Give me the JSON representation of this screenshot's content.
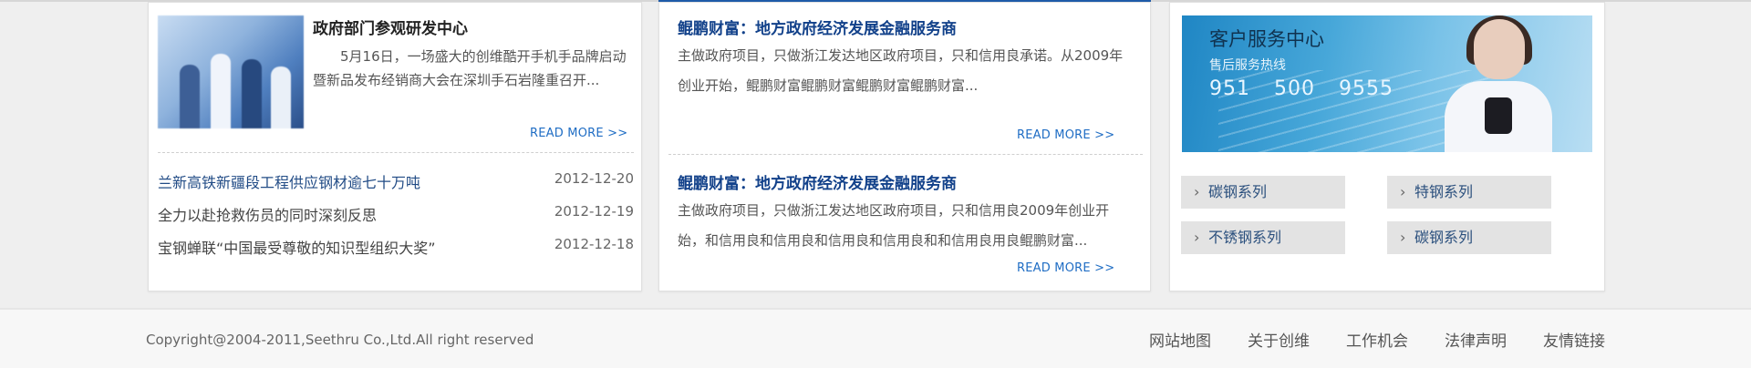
{
  "featured": {
    "title": "政府部门参观研发中心",
    "description": "5月16日，一场盛大的创维酷开手机手品牌启动暨新品发布经销商大会在深圳手石岩隆重召开...",
    "read_more": "READ MORE >>"
  },
  "news": [
    {
      "title": "兰新高铁新疆段工程供应钢材逾七十万吨",
      "date": "2012-12-20"
    },
    {
      "title": "全力以赴抢救伤员的同时深刻反思",
      "date": "2012-12-19"
    },
    {
      "title": "宝钢蝉联“中国最受尊敬的知识型组织大奖”",
      "date": "2012-12-18"
    }
  ],
  "articles": [
    {
      "title": "鲲鹏财富：地方政府经济发展金融服务商",
      "text": "主做政府项目，只做浙江发达地区政府项目，只和信用良承诺。从2009年创业开始，鲲鹏财富鲲鹏财富鲲鹏财富鲲鹏财富...",
      "read_more": "READ MORE >>"
    },
    {
      "title": "鲲鹏财富：地方政府经济发展金融服务商",
      "text": "主做政府项目，只做浙江发达地区政府项目，只和信用良2009年创业开始，和信用良和信用良和信用良和信用良和和信用良用良鲲鹏财富...",
      "read_more": "READ MORE >>"
    }
  ],
  "service": {
    "title": "客户服务中心",
    "subtitle": "售后服务热线",
    "phone": [
      "951",
      "500",
      "9555"
    ]
  },
  "series": [
    "碳钢系列",
    "特钢系列",
    "不锈钢系列",
    "碳钢系列"
  ],
  "footer": {
    "copyright": "Copyright@2004-2011,Seethru Co.,Ltd.All right reserved",
    "links": [
      "网站地图",
      "关于创维",
      "工作机会",
      "法律声明",
      "友情链接"
    ]
  },
  "colors": {
    "accent_blue": "#1e5aa8",
    "title_blue": "#12418a",
    "readmore_blue": "#1f6dc4",
    "button_gray": "#e3e3e3"
  }
}
